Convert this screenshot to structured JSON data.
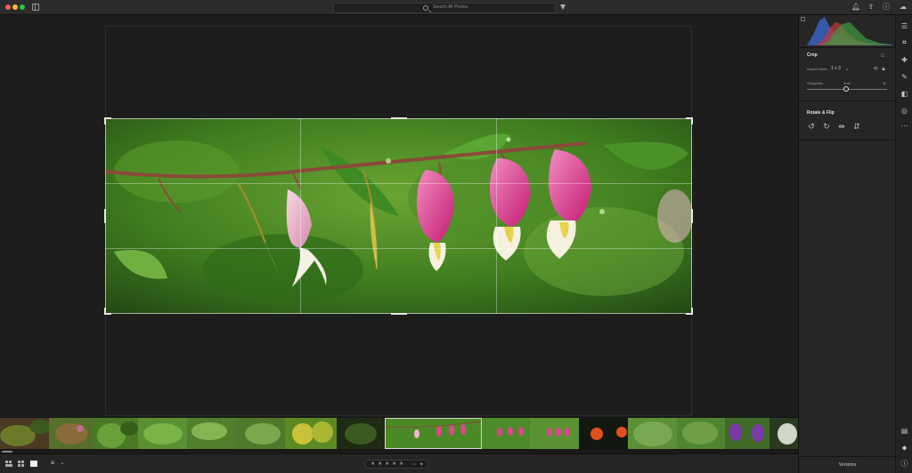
{
  "titlebar": {
    "search_placeholder": "Search All Photos",
    "icons": [
      "sidebar-icon",
      "search-icon",
      "filter-icon",
      "bell-icon",
      "share-icon",
      "help-icon",
      "cloud-icon"
    ]
  },
  "panel": {
    "crop_title": "Crop",
    "aspect_label": "Aspect Ratio",
    "aspect_value": "1 x 3",
    "straighten_label": "Straighten",
    "straighten_auto": "Auto",
    "straighten_value": "0",
    "rotate_title": "Rotate & Flip",
    "versions_label": "Versions"
  },
  "tools": [
    "edit-sliders-icon",
    "crop-icon",
    "healing-icon",
    "brush-icon",
    "gradient-icon",
    "radial-icon",
    "more-icon",
    "comment-icon",
    "tag-icon",
    "info-icon"
  ],
  "bottombar": {
    "stars": [
      "★",
      "★",
      "★",
      "★",
      "★"
    ],
    "flag_symbol": "⚐",
    "reject_symbol": "⚑"
  },
  "colors": {
    "accent_selected": "#d8d8d8",
    "panel_bg": "#262626",
    "canvas_bg": "#1d1d1d"
  }
}
